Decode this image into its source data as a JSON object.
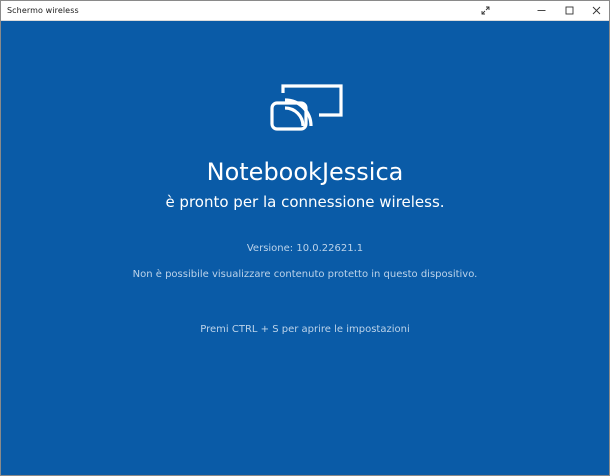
{
  "window": {
    "title": "Schermo wireless"
  },
  "titlebar_buttons": {
    "fullscreen": "expand-icon",
    "minimize": "minimize-icon",
    "maximize": "maximize-icon",
    "close": "close-icon"
  },
  "main": {
    "icon": "cast-screen-icon",
    "device_name": "NotebookJessica",
    "ready_text": "è pronto per la connessione wireless.",
    "version": "Versione: 10.0.22621.1",
    "protected_notice": "Non è possibile visualizzare contenuto protetto in questo dispositivo.",
    "settings_hint": "Premi CTRL + S per aprire le impostazioni"
  },
  "colors": {
    "background": "#0a5ba7",
    "primary_text": "#ffffff",
    "secondary_text": "#bcd3ea"
  }
}
